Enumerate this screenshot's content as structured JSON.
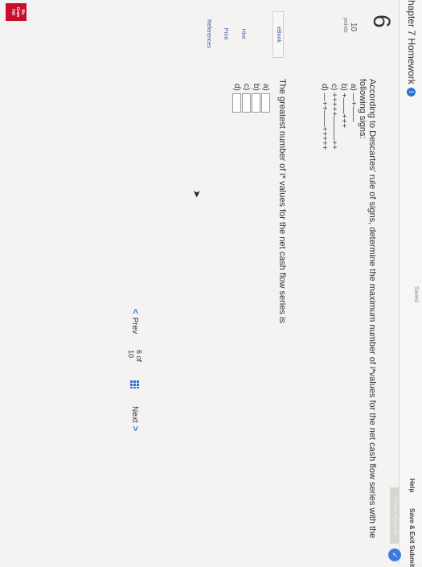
{
  "header": {
    "chapter_title": "hapter 7 Homework",
    "info_badge": "i",
    "saved_text": "Saved",
    "help": "Help",
    "save_exit": "Save & Exit",
    "submit": "Submit",
    "check_work": "Check my work"
  },
  "question": {
    "number": "6",
    "points_value": "10",
    "points_label": "points",
    "prompt": "According to Descartes' rule of signs, determine the maximum number of i*values for the net cash flow series with the following signs:",
    "options": [
      "a) —+——",
      "b) +——+++",
      "c) +++++———++",
      "d) —++——+++++"
    ],
    "answer_prompt": "The greatest number of i* values for the net cash flow series is",
    "answer_labels": [
      "a)",
      "b)",
      "c)",
      "d)"
    ]
  },
  "sidebar": {
    "ebook": "eBook",
    "hint": "Hint",
    "print": "Print",
    "references": "References"
  },
  "pager": {
    "prev": "Prev",
    "page": "6",
    "of": "of",
    "total": "10",
    "next": "Next"
  },
  "logo": {
    "text": "Mc Graw Hill Education"
  },
  "colors": {
    "accent_blue": "#2d6fd0",
    "logo_red": "#c8102e"
  }
}
